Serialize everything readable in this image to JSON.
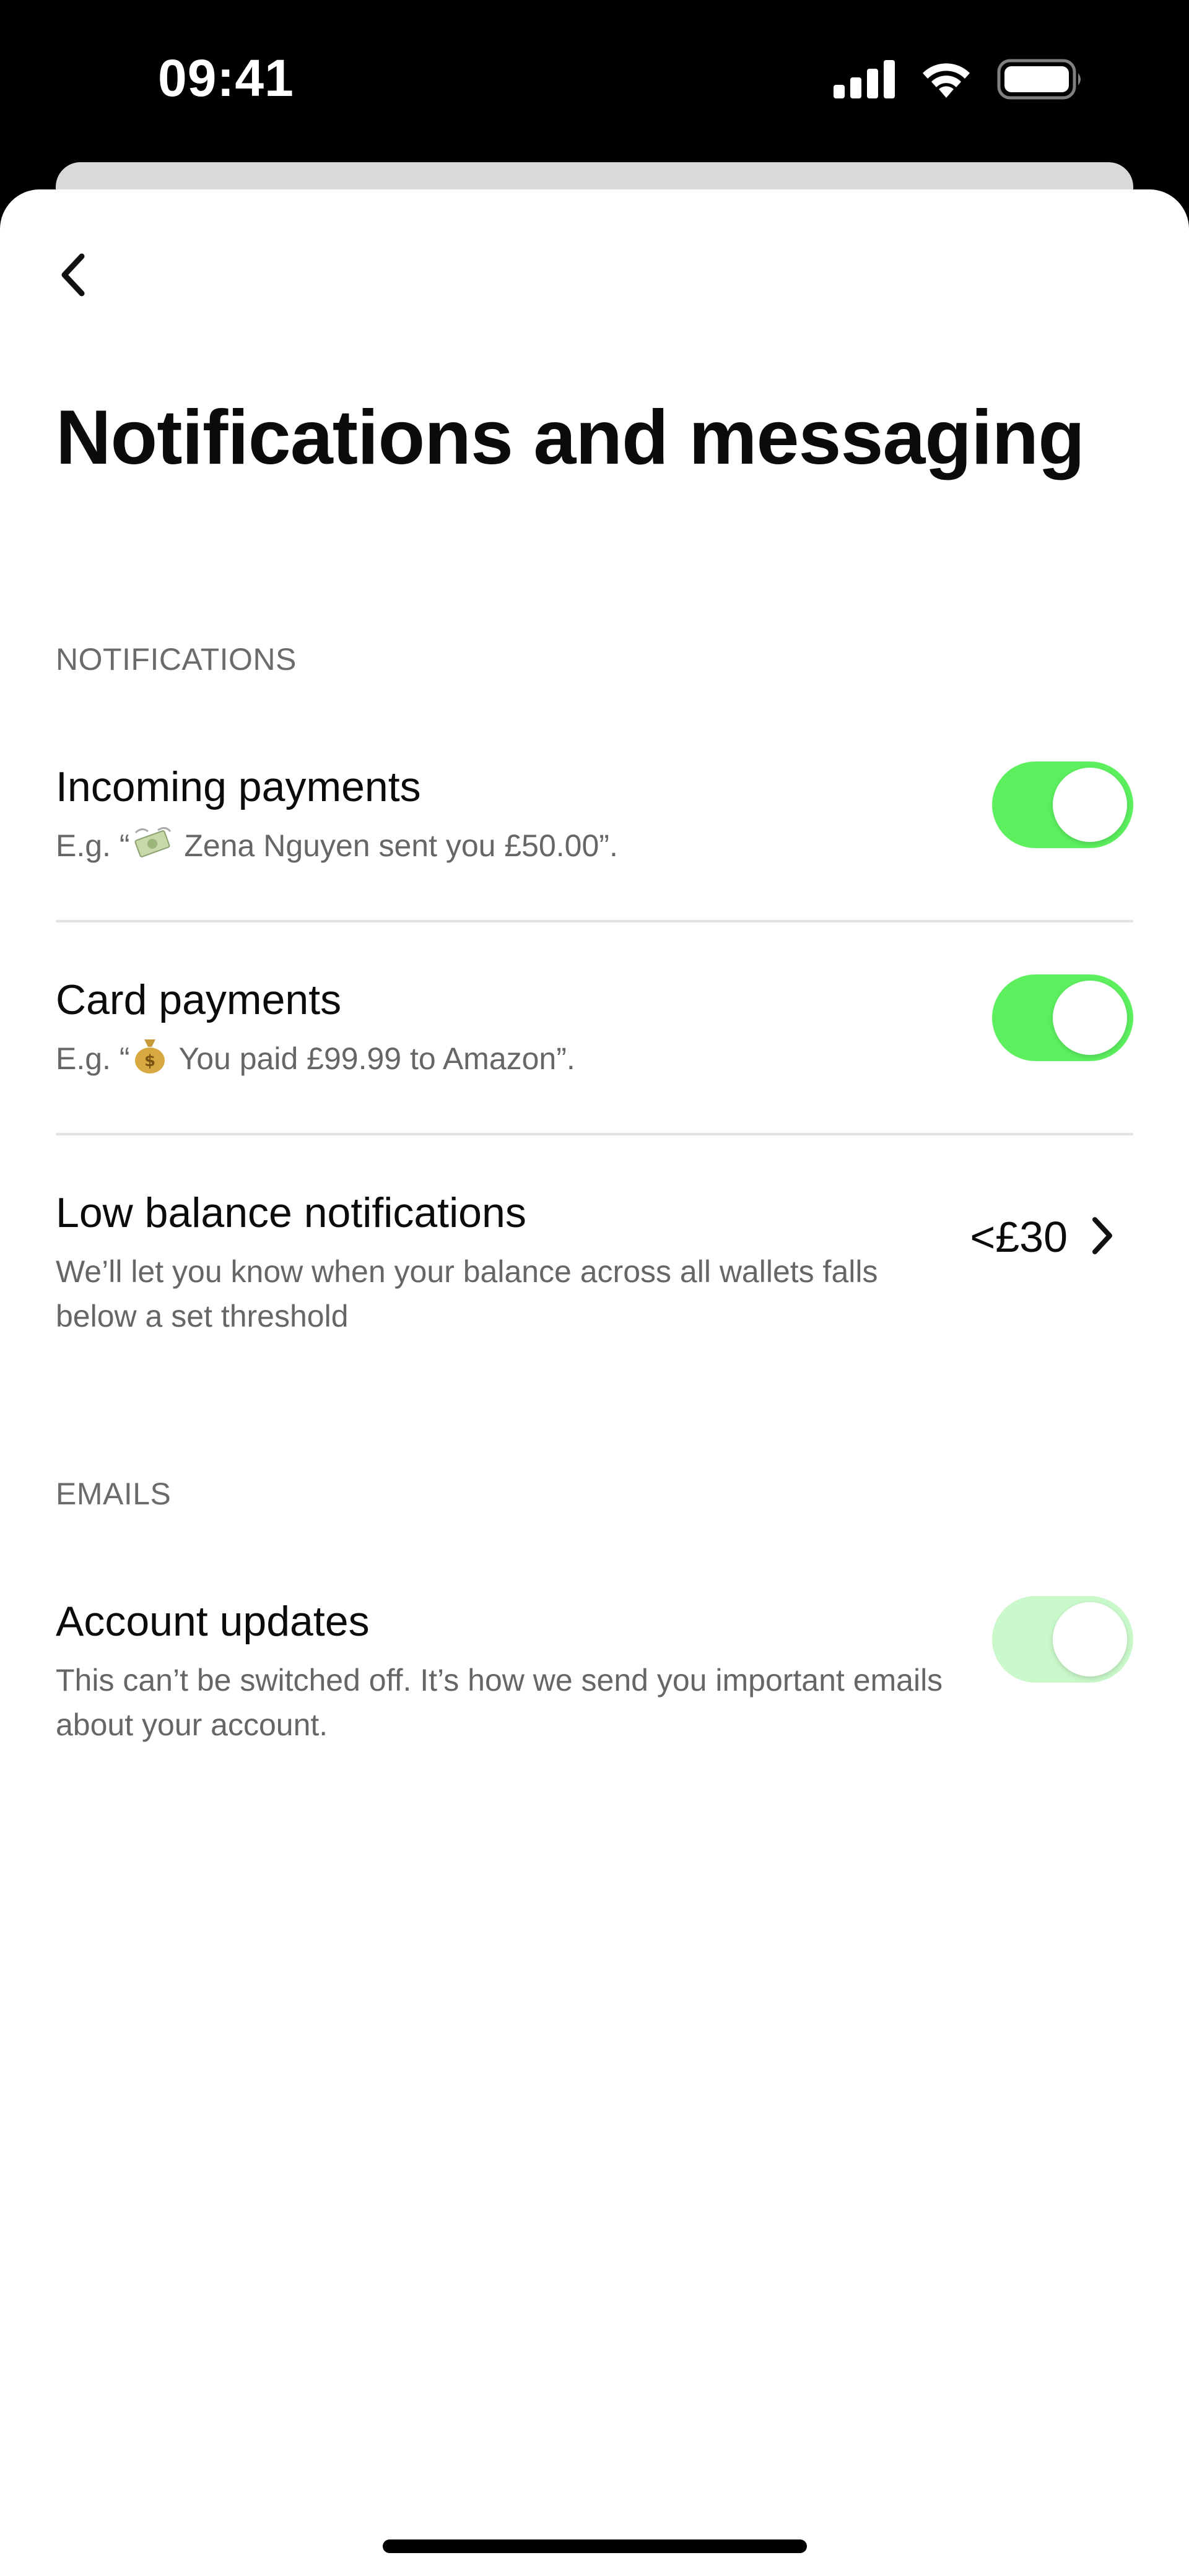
{
  "status_bar": {
    "time": "09:41",
    "icons": [
      "signal-icon",
      "wifi-icon",
      "battery-icon"
    ]
  },
  "header": {
    "back_icon": "chevron-left-icon",
    "title": "Notifications and messaging"
  },
  "sections": {
    "notifications": {
      "label": "NOTIFICATIONS",
      "items": [
        {
          "title": "Incoming payments",
          "desc_prefix": "E.g. “",
          "desc_icon": "money-with-wings-icon",
          "desc_suffix": " Zena Nguyen sent you £50.00”.",
          "toggle": "on"
        },
        {
          "title": "Card payments",
          "desc_prefix": "E.g. “",
          "desc_icon": "money-bag-icon",
          "desc_suffix": " You paid £99.99 to Amazon”.",
          "toggle": "on"
        },
        {
          "title": "Low balance notifications",
          "desc": "We’ll let you know when your balance across all wallets falls below a set threshold",
          "threshold": "<£30"
        }
      ]
    },
    "emails": {
      "label": "EMAILS",
      "items": [
        {
          "title": "Account updates",
          "desc": "This can’t be switched off. It’s how we send you important emails about your account.",
          "toggle": "on-disabled"
        }
      ]
    }
  },
  "colors": {
    "toggle_on": "#5cf05f",
    "toggle_disabled": "#c9f8ca",
    "text_primary": "#0b0b0b",
    "text_secondary": "#666666"
  }
}
